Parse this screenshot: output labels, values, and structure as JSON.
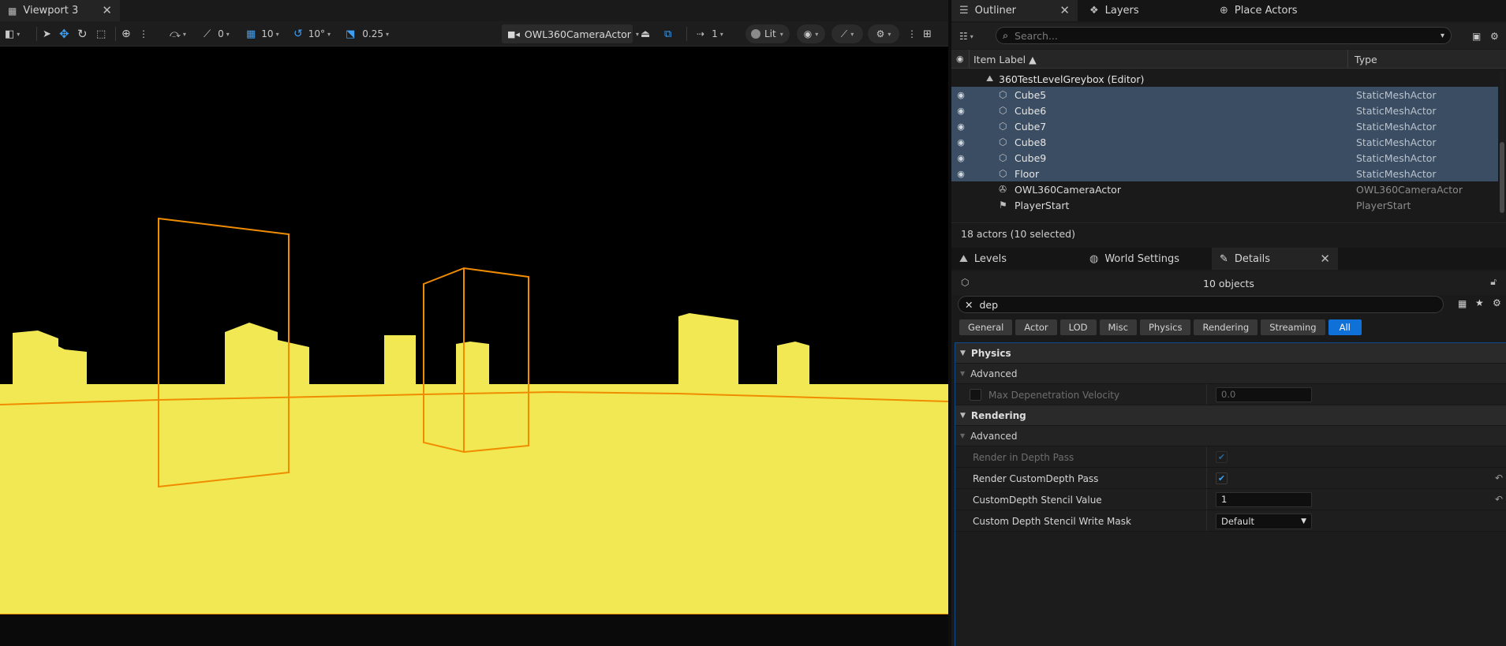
{
  "viewport": {
    "tab_title": "Viewport 3",
    "toolbar": {
      "rotation_snap_count": "0",
      "grid_snap": "10",
      "angle_snap": "10°",
      "scale_snap": "0.25",
      "camera": "OWL360CameraActor",
      "speed": "1",
      "view_mode": "Lit"
    }
  },
  "outliner": {
    "tabs": [
      "Outliner",
      "Layers",
      "Place Actors"
    ],
    "search_placeholder": "Search...",
    "columns": {
      "label": "Item Label ▲",
      "type": "Type"
    },
    "world_row": "360TestLevelGreybox (Editor)",
    "rows": [
      {
        "name": "Cube5",
        "type": "StaticMeshActor"
      },
      {
        "name": "Cube6",
        "type": "StaticMeshActor"
      },
      {
        "name": "Cube7",
        "type": "StaticMeshActor"
      },
      {
        "name": "Cube8",
        "type": "StaticMeshActor"
      },
      {
        "name": "Cube9",
        "type": "StaticMeshActor"
      },
      {
        "name": "Floor",
        "type": "StaticMeshActor"
      },
      {
        "name": "OWL360CameraActor",
        "type": "OWL360CameraActor"
      },
      {
        "name": "PlayerStart",
        "type": "PlayerStart"
      }
    ],
    "footer": "18 actors (10 selected)"
  },
  "details": {
    "tabs": [
      "Levels",
      "World Settings",
      "Details"
    ],
    "objects_count": "10 objects",
    "search_value": "dep",
    "filters": [
      "General",
      "Actor",
      "LOD",
      "Misc",
      "Physics",
      "Rendering",
      "Streaming",
      "All"
    ],
    "sections": {
      "physics": "Physics",
      "advanced": "Advanced",
      "rendering": "Rendering"
    },
    "props": {
      "max_depen_label": "Max Depenetration Velocity",
      "max_depen_value": "0.0",
      "render_depth_label": "Render in Depth Pass",
      "render_custom_label": "Render CustomDepth Pass",
      "stencil_value_label": "CustomDepth Stencil Value",
      "stencil_value": "1",
      "stencil_mask_label": "Custom Depth Stencil Write Mask",
      "stencil_mask_value": "Default"
    }
  },
  "colors": {
    "accent": "#0f70d7",
    "floor": "#f2e854",
    "selection_outline": "#f08c00",
    "selected_row": "#3b4d63"
  }
}
